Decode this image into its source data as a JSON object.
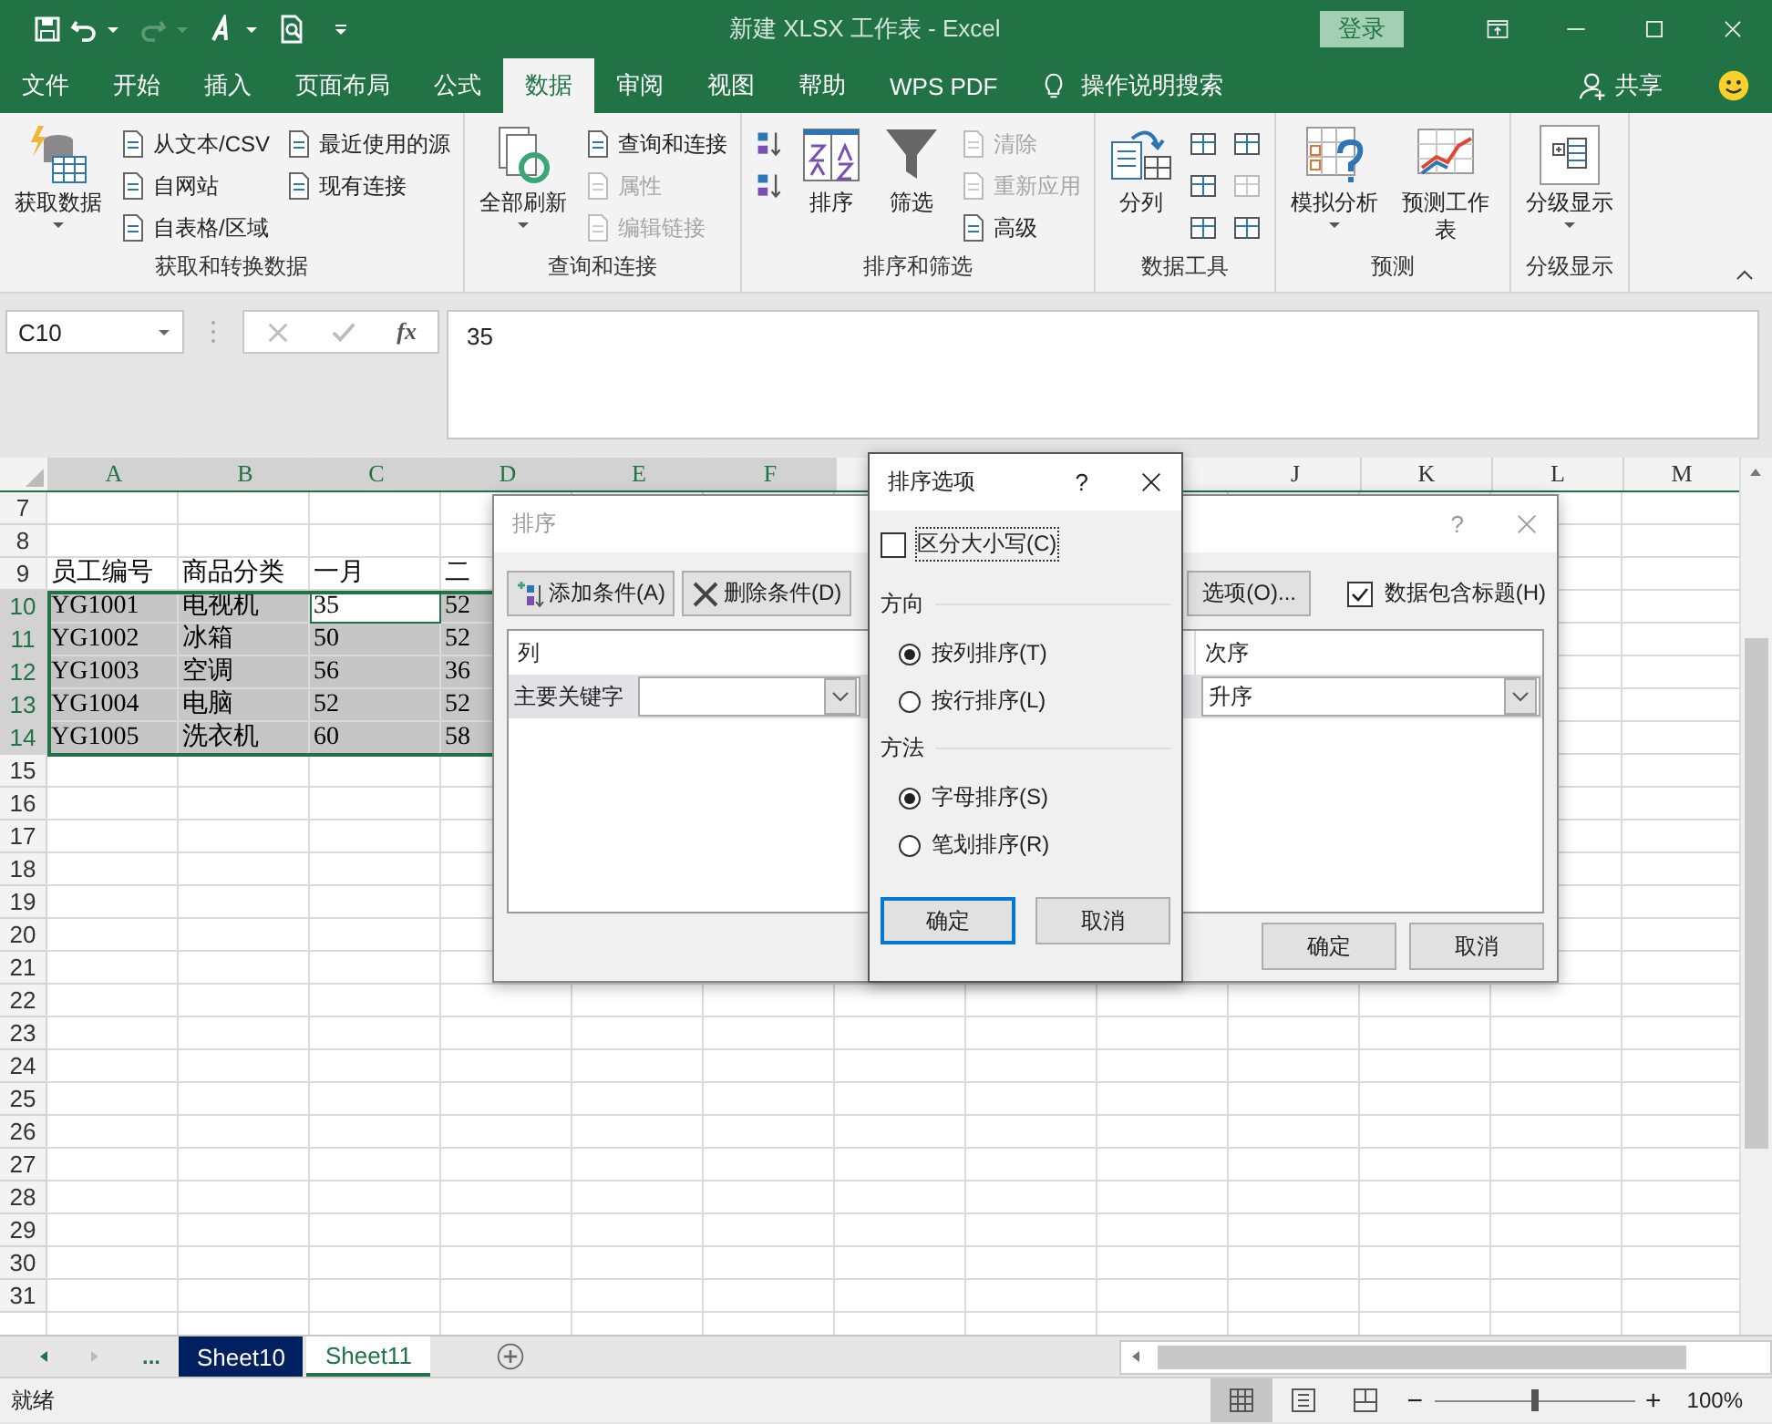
{
  "title_bar": {
    "title": "新建 XLSX 工作表  -  Excel",
    "sign_in": "登录"
  },
  "tabs": [
    {
      "label": "文件",
      "selected": false
    },
    {
      "label": "开始",
      "selected": false
    },
    {
      "label": "插入",
      "selected": false
    },
    {
      "label": "页面布局",
      "selected": false
    },
    {
      "label": "公式",
      "selected": false
    },
    {
      "label": "数据",
      "selected": true
    },
    {
      "label": "审阅",
      "selected": false
    },
    {
      "label": "视图",
      "selected": false
    },
    {
      "label": "帮助",
      "selected": false
    },
    {
      "label": "WPS PDF",
      "selected": false
    }
  ],
  "tell_me": "操作说明搜索",
  "share": "共享",
  "ribbon": {
    "groups": [
      {
        "label": "获取和转换数据",
        "stacks": [
          {
            "kind": "large",
            "label": "获取数据",
            "dropdown": true,
            "disabled": false
          },
          {
            "kind": "column",
            "items": [
              {
                "kind": "small",
                "label": "从文本/CSV",
                "disabled": false
              },
              {
                "kind": "small",
                "label": "自网站",
                "disabled": false
              },
              {
                "kind": "small",
                "label": "自表格/区域",
                "disabled": false
              }
            ]
          },
          {
            "kind": "column",
            "items": [
              {
                "kind": "small",
                "label": "最近使用的源",
                "disabled": false
              },
              {
                "kind": "small",
                "label": "现有连接",
                "disabled": false
              }
            ]
          }
        ]
      },
      {
        "label": "查询和连接",
        "stacks": [
          {
            "kind": "large",
            "label": "全部刷新",
            "dropdown": true,
            "disabled": false
          },
          {
            "kind": "column",
            "items": [
              {
                "kind": "small",
                "label": "查询和连接",
                "disabled": false
              },
              {
                "kind": "small",
                "label": "属性",
                "disabled": true
              },
              {
                "kind": "small",
                "label": "编辑链接",
                "disabled": true
              }
            ]
          }
        ]
      },
      {
        "label": "排序和筛选",
        "stacks": [
          {
            "kind": "column",
            "items": [
              {
                "kind": "sort"
              },
              {
                "kind": "sort"
              }
            ]
          },
          {
            "kind": "large",
            "label": "排序",
            "dropdown": false,
            "disabled": false
          },
          {
            "kind": "large",
            "label": "筛选",
            "dropdown": false,
            "disabled": false
          },
          {
            "kind": "column",
            "items": [
              {
                "kind": "small",
                "label": "清除",
                "disabled": true
              },
              {
                "kind": "small",
                "label": "重新应用",
                "disabled": true
              },
              {
                "kind": "small",
                "label": "高级",
                "disabled": false
              }
            ]
          }
        ]
      },
      {
        "label": "数据工具",
        "stacks": [
          {
            "kind": "large",
            "label": "分列",
            "dropdown": false,
            "disabled": false
          },
          {
            "kind": "column",
            "items": [
              {
                "kind": "tool",
                "disabled": false
              },
              {
                "kind": "tool",
                "disabled": false
              },
              {
                "kind": "tool",
                "disabled": false
              }
            ]
          },
          {
            "kind": "column",
            "items": [
              {
                "kind": "tool",
                "disabled": false
              },
              {
                "kind": "tool",
                "disabled": true
              },
              {
                "kind": "tool",
                "disabled": false
              }
            ]
          }
        ]
      },
      {
        "label": "预测",
        "stacks": [
          {
            "kind": "large",
            "label": "模拟分析",
            "dropdown": true,
            "disabled": false
          },
          {
            "kind": "large",
            "label": "预测工作表",
            "dropdown": false,
            "disabled": false
          }
        ]
      },
      {
        "label": "分级显示",
        "stacks": [
          {
            "kind": "large",
            "label": "分级显示",
            "dropdown": true,
            "disabled": false
          }
        ]
      }
    ]
  },
  "formula_bar": {
    "name_box": "C10",
    "fx": "fx",
    "value": "35"
  },
  "sheet": {
    "columns_left": [
      {
        "label": "A",
        "selected": true
      },
      {
        "label": "B",
        "selected": true
      },
      {
        "label": "C",
        "selected": true
      },
      {
        "label": "D",
        "selected": true
      },
      {
        "label": "E",
        "selected": true
      },
      {
        "label": "F",
        "selected": true
      }
    ],
    "columns_right": [
      {
        "label": "J",
        "selected": false
      },
      {
        "label": "K",
        "selected": false
      },
      {
        "label": "L",
        "selected": false
      },
      {
        "label": "M",
        "selected": false
      }
    ],
    "rows": [
      {
        "number": "7",
        "selected": false
      },
      {
        "number": "8",
        "selected": false
      },
      {
        "number": "9",
        "selected": false,
        "cells": [
          {
            "text": "员工编号",
            "active": false
          },
          {
            "text": "商品分类",
            "active": false
          },
          {
            "text": "一月",
            "active": false
          },
          {
            "text": "二",
            "active": false
          }
        ]
      },
      {
        "number": "10",
        "selected": true,
        "cells": [
          {
            "text": "YG1001",
            "active": false
          },
          {
            "text": "电视机",
            "active": false
          },
          {
            "text": "35",
            "active": true
          },
          {
            "text": "52",
            "active": false
          }
        ]
      },
      {
        "number": "11",
        "selected": true,
        "cells": [
          {
            "text": "YG1002",
            "active": false
          },
          {
            "text": "冰箱",
            "active": false
          },
          {
            "text": "50",
            "active": false
          },
          {
            "text": "52",
            "active": false
          }
        ]
      },
      {
        "number": "12",
        "selected": true,
        "cells": [
          {
            "text": "YG1003",
            "active": false
          },
          {
            "text": "空调",
            "active": false
          },
          {
            "text": "56",
            "active": false
          },
          {
            "text": "36",
            "active": false
          }
        ]
      },
      {
        "number": "13",
        "selected": true,
        "cells": [
          {
            "text": "YG1004",
            "active": false
          },
          {
            "text": "电脑",
            "active": false
          },
          {
            "text": "52",
            "active": false
          },
          {
            "text": "52",
            "active": false
          }
        ]
      },
      {
        "number": "14",
        "selected": true,
        "cells": [
          {
            "text": "YG1005",
            "active": false
          },
          {
            "text": "洗衣机",
            "active": false
          },
          {
            "text": "60",
            "active": false
          },
          {
            "text": "58",
            "active": false
          }
        ]
      },
      {
        "number": "15",
        "selected": false
      },
      {
        "number": "16",
        "selected": false
      },
      {
        "number": "17",
        "selected": false
      },
      {
        "number": "18",
        "selected": false
      },
      {
        "number": "19",
        "selected": false
      },
      {
        "number": "20",
        "selected": false
      },
      {
        "number": "21",
        "selected": false
      },
      {
        "number": "22",
        "selected": false
      },
      {
        "number": "23",
        "selected": false
      },
      {
        "number": "24",
        "selected": false
      },
      {
        "number": "25",
        "selected": false
      },
      {
        "number": "26",
        "selected": false
      },
      {
        "number": "27",
        "selected": false
      },
      {
        "number": "28",
        "selected": false
      },
      {
        "number": "29",
        "selected": false
      },
      {
        "number": "30",
        "selected": false
      },
      {
        "number": "31",
        "selected": false
      }
    ]
  },
  "sort_dialog": {
    "title": "排序",
    "help": "?",
    "add_button": "添加条件(A)",
    "delete_button": "删除条件(D)",
    "options_button": "选项(O)...",
    "has_headers": {
      "label": "数据包含标题(H)",
      "checked": true
    },
    "column_header": "列",
    "order_header": "次序",
    "row_label": "主要关键字",
    "order_value": "升序",
    "ok": "确定",
    "cancel": "取消"
  },
  "options_dialog": {
    "title": "排序选项",
    "help": "?",
    "case_sensitive": {
      "label": "区分大小写(C)",
      "checked": false
    },
    "direction": {
      "label": "方向",
      "options": [
        {
          "label": "按列排序(T)",
          "selected": true
        },
        {
          "label": "按行排序(L)",
          "selected": false
        }
      ]
    },
    "method": {
      "label": "方法",
      "options": [
        {
          "label": "字母排序(S)",
          "selected": true
        },
        {
          "label": "笔划排序(R)",
          "selected": false
        }
      ]
    },
    "ok": "确定",
    "cancel": "取消"
  },
  "sheet_tabs": {
    "more": "...",
    "tabs": [
      {
        "label": "Sheet10",
        "selected": false,
        "color": "#002060"
      },
      {
        "label": "Sheet11",
        "selected": true
      }
    ]
  },
  "status_bar": {
    "text": "就绪",
    "zoom": "100%",
    "zoom_out": "−",
    "zoom_in": "+",
    "views": [
      {
        "selected": true
      },
      {
        "selected": false
      },
      {
        "selected": false
      }
    ],
    "zoom_slider": {
      "level": 0.5
    }
  }
}
